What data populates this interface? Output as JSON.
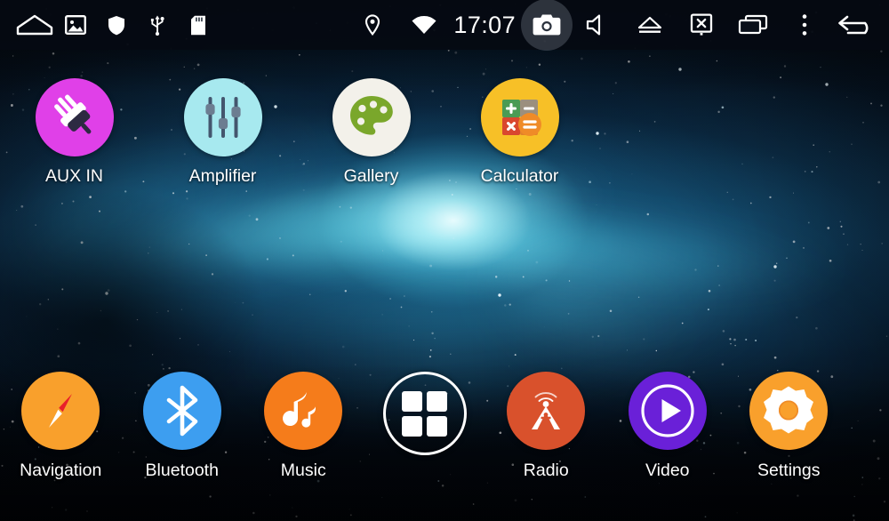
{
  "statusbar": {
    "time": "17:07",
    "left_icons": [
      {
        "name": "home-icon",
        "label": "Home"
      },
      {
        "name": "image-icon",
        "label": "Picture"
      },
      {
        "name": "shield-icon",
        "label": "Security"
      },
      {
        "name": "usb-icon",
        "label": "USB"
      },
      {
        "name": "sd-card-icon",
        "label": "SD Card"
      }
    ],
    "right_icons": [
      {
        "name": "location-icon",
        "label": "GPS"
      },
      {
        "name": "wifi-icon",
        "label": "Wi-Fi"
      },
      {
        "name": "camera-icon",
        "label": "Camera",
        "active": true
      },
      {
        "name": "volume-mute-icon",
        "label": "Mute"
      },
      {
        "name": "eject-icon",
        "label": "Eject"
      },
      {
        "name": "screen-off-icon",
        "label": "Screen Off"
      },
      {
        "name": "recent-apps-icon",
        "label": "Recent Apps"
      },
      {
        "name": "overflow-menu-icon",
        "label": "More"
      },
      {
        "name": "back-icon",
        "label": "Back"
      }
    ]
  },
  "home": {
    "top_row": [
      {
        "id": "aux-in",
        "label": "AUX IN",
        "icon": "plug-icon",
        "bg": "#e040e8"
      },
      {
        "id": "amplifier",
        "label": "Amplifier",
        "icon": "equalizer-icon",
        "bg": "#a7e9ef"
      },
      {
        "id": "gallery",
        "label": "Gallery",
        "icon": "palette-icon",
        "bg": "#f3f1ea"
      },
      {
        "id": "calculator",
        "label": "Calculator",
        "icon": "calculator-icon",
        "bg": "#f7c027"
      }
    ],
    "bottom_row": [
      {
        "id": "navigation",
        "label": "Navigation",
        "icon": "compass-icon",
        "bg": "#f9a02c"
      },
      {
        "id": "bluetooth",
        "label": "Bluetooth",
        "icon": "bluetooth-icon",
        "bg": "#3d9ef0"
      },
      {
        "id": "music",
        "label": "Music",
        "icon": "music-note-icon",
        "bg": "#f57c1b"
      },
      {
        "id": "app-drawer",
        "label": "",
        "icon": "app-grid-icon",
        "bg": "transparent"
      },
      {
        "id": "radio",
        "label": "Radio",
        "icon": "antenna-icon",
        "bg": "#d9512c"
      },
      {
        "id": "video",
        "label": "Video",
        "icon": "play-icon",
        "bg": "#6a20d8"
      },
      {
        "id": "settings",
        "label": "Settings",
        "icon": "gear-icon",
        "bg": "#f9a02c"
      }
    ]
  },
  "colors": {
    "status_bar_bg": "#050a12",
    "label_text": "#ffffff",
    "nebula_core": "#9beef8",
    "nebula_mid": "#1e78a5"
  }
}
